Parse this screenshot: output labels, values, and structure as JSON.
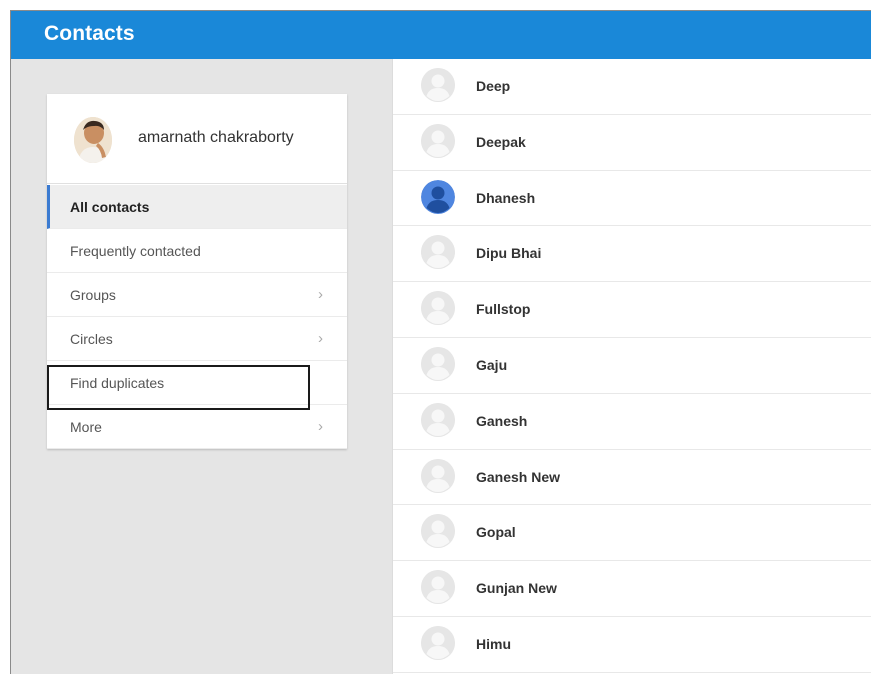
{
  "header": {
    "title": "Contacts"
  },
  "colors": {
    "header": "#1a88d8",
    "active_accent": "#3b7bd1",
    "colored_avatar": "#4f86e0"
  },
  "profile": {
    "name": "amarnath chakraborty"
  },
  "nav": {
    "items": [
      {
        "label": "All contacts",
        "active": true,
        "chevron": ""
      },
      {
        "label": "Frequently contacted",
        "active": false,
        "chevron": ""
      },
      {
        "label": "Groups",
        "active": false,
        "chevron": "›"
      },
      {
        "label": "Circles",
        "active": false,
        "chevron": "›"
      },
      {
        "label": "Find duplicates",
        "active": false,
        "chevron": ""
      },
      {
        "label": "More",
        "active": false,
        "chevron": "›"
      }
    ]
  },
  "contacts": [
    {
      "name": "Deep",
      "avatar": "default-person-icon"
    },
    {
      "name": "Deepak",
      "avatar": "default-person-icon"
    },
    {
      "name": "Dhanesh",
      "avatar": "blue-person-icon"
    },
    {
      "name": "Dipu Bhai",
      "avatar": "default-person-icon"
    },
    {
      "name": "Fullstop",
      "avatar": "default-person-icon"
    },
    {
      "name": "Gaju",
      "avatar": "default-person-icon"
    },
    {
      "name": "Ganesh",
      "avatar": "default-person-icon"
    },
    {
      "name": "Ganesh New",
      "avatar": "default-person-icon"
    },
    {
      "name": "Gopal",
      "avatar": "default-person-icon"
    },
    {
      "name": "Gunjan New",
      "avatar": "default-person-icon"
    },
    {
      "name": "Himu",
      "avatar": "default-person-icon"
    }
  ]
}
